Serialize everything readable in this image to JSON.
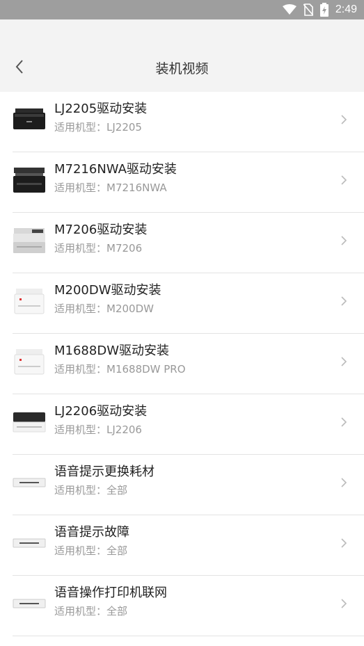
{
  "status_bar": {
    "time": "2:49"
  },
  "header": {
    "title": "装机视频"
  },
  "items": [
    {
      "title": "LJ2205驱动安装",
      "subtitle": "适用机型：LJ2205",
      "icon": "printer-black-icon"
    },
    {
      "title": "M7216NWA驱动安装",
      "subtitle": "适用机型：M7216NWA",
      "icon": "printer-mfp-black-icon"
    },
    {
      "title": "M7206驱动安装",
      "subtitle": "适用机型：M7206",
      "icon": "printer-mfp-gray-icon"
    },
    {
      "title": "M200DW驱动安装",
      "subtitle": "适用机型：M200DW",
      "icon": "printer-white-icon"
    },
    {
      "title": "M1688DW驱动安装",
      "subtitle": "适用机型：M1688DW PRO",
      "icon": "printer-white-icon"
    },
    {
      "title": "LJ2206驱动安装",
      "subtitle": "适用机型：LJ2206",
      "icon": "printer-black-white-icon"
    },
    {
      "title": "语音提示更换耗材",
      "subtitle": "适用机型：全部",
      "icon": "printer-flat-icon"
    },
    {
      "title": "语音提示故障",
      "subtitle": "适用机型：全部",
      "icon": "printer-flat-icon"
    },
    {
      "title": "语音操作打印机联网",
      "subtitle": "适用机型：全部",
      "icon": "printer-flat-icon"
    }
  ]
}
